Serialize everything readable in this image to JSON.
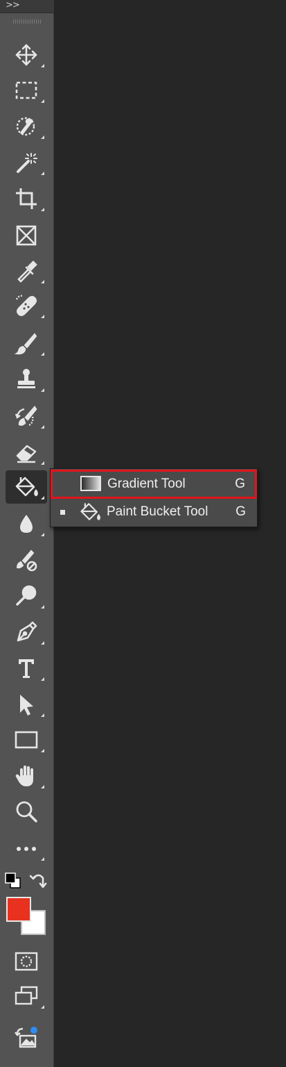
{
  "toolbar": {
    "collapse_label": ">>",
    "tools": [
      {
        "name": "move-tool",
        "icon": "move-icon",
        "has_submenu": true
      },
      {
        "name": "rectangular-marquee-tool",
        "icon": "marquee-icon",
        "has_submenu": true
      },
      {
        "name": "object-selection-tool",
        "icon": "object-selection-icon",
        "has_submenu": true
      },
      {
        "name": "magic-wand-tool",
        "icon": "magic-wand-icon",
        "has_submenu": true
      },
      {
        "name": "crop-tool",
        "icon": "crop-icon",
        "has_submenu": true
      },
      {
        "name": "frame-tool",
        "icon": "frame-icon",
        "has_submenu": false
      },
      {
        "name": "eyedropper-tool",
        "icon": "eyedropper-icon",
        "has_submenu": true
      },
      {
        "name": "spot-healing-brush-tool",
        "icon": "healing-brush-icon",
        "has_submenu": true
      },
      {
        "name": "brush-tool",
        "icon": "brush-icon",
        "has_submenu": true
      },
      {
        "name": "clone-stamp-tool",
        "icon": "stamp-icon",
        "has_submenu": true
      },
      {
        "name": "history-brush-tool",
        "icon": "history-brush-icon",
        "has_submenu": true
      },
      {
        "name": "eraser-tool",
        "icon": "eraser-icon",
        "has_submenu": true
      },
      {
        "name": "paint-bucket-tool",
        "icon": "paint-bucket-icon",
        "has_submenu": true,
        "active": true
      },
      {
        "name": "blur-tool",
        "icon": "blur-drop-icon",
        "has_submenu": true
      },
      {
        "name": "smudge-tool",
        "icon": "smudge-icon",
        "has_submenu": false
      },
      {
        "name": "dodge-tool",
        "icon": "dodge-icon",
        "has_submenu": true
      },
      {
        "name": "pen-tool",
        "icon": "pen-icon",
        "has_submenu": true
      },
      {
        "name": "type-tool",
        "icon": "type-icon",
        "has_submenu": true
      },
      {
        "name": "path-selection-tool",
        "icon": "arrow-icon",
        "has_submenu": true
      },
      {
        "name": "rectangle-tool",
        "icon": "rectangle-icon",
        "has_submenu": true
      },
      {
        "name": "hand-tool",
        "icon": "hand-icon",
        "has_submenu": true
      },
      {
        "name": "zoom-tool",
        "icon": "zoom-icon",
        "has_submenu": false
      },
      {
        "name": "edit-toolbar",
        "icon": "more-icon",
        "has_submenu": true
      }
    ],
    "colors": {
      "foreground": "#e8321f",
      "background": "#ffffff"
    }
  },
  "flyout": {
    "items": [
      {
        "label": "Gradient Tool",
        "shortcut": "G",
        "icon": "gradient-icon",
        "highlighted": true,
        "selected": false
      },
      {
        "label": "Paint Bucket Tool",
        "shortcut": "G",
        "icon": "paint-bucket-icon",
        "highlighted": false,
        "selected": true
      }
    ],
    "highlight_color": "#e3141b"
  }
}
